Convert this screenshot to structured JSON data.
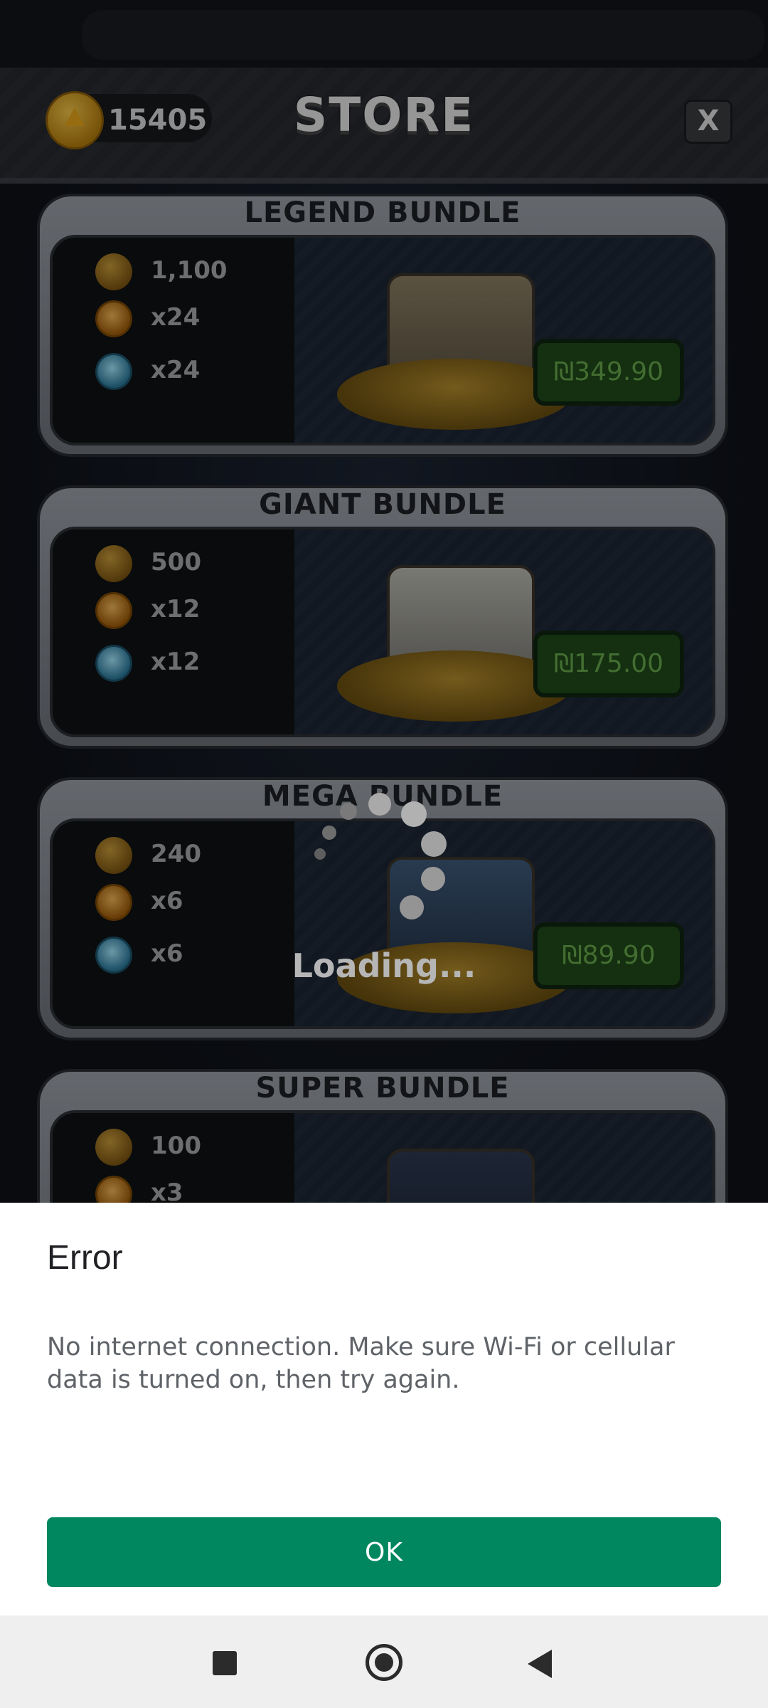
{
  "store": {
    "title": "STORE",
    "coin_balance": "15405",
    "close_label": "X",
    "loading_text": "Loading..."
  },
  "bundles": [
    {
      "name": "LEGEND BUNDLE",
      "coins": "1,100",
      "orange_count": "x24",
      "blue_count": "x24",
      "price": "₪349.90"
    },
    {
      "name": "GIANT BUNDLE",
      "coins": "500",
      "orange_count": "x12",
      "blue_count": "x12",
      "price": "₪175.00"
    },
    {
      "name": "MEGA BUNDLE",
      "coins": "240",
      "orange_count": "x6",
      "blue_count": "x6",
      "price": "₪89.90"
    },
    {
      "name": "SUPER BUNDLE",
      "coins": "100",
      "orange_count": "x3"
    }
  ],
  "dialog": {
    "title": "Error",
    "message": "No internet connection. Make sure Wi-Fi or cellular data is turned on, then try again.",
    "ok_label": "OK",
    "accent_color": "#01875f"
  },
  "navbar": {
    "icons": [
      "recent-apps-icon",
      "home-icon",
      "back-icon"
    ]
  }
}
